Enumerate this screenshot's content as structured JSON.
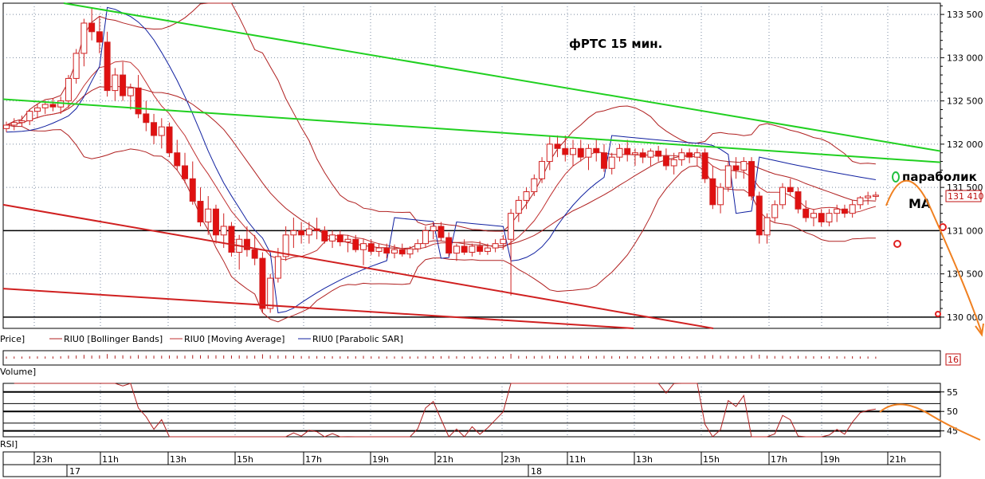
{
  "chart_data": [
    {
      "type": "candlestick",
      "title": "фРТС   15 мин.",
      "y_ticks": [
        130000,
        130500,
        131000,
        131500,
        132000,
        132500,
        133000,
        133500
      ],
      "y_tick_labels": [
        "130 000",
        "130 500",
        "131 000",
        "131 500",
        "132 000",
        "132 500",
        "133 000",
        "133 500"
      ],
      "ylim": [
        129870,
        133630
      ],
      "last_price": 131410,
      "last_price_label": "131 410",
      "x_time_labels": [
        "23h",
        "11h",
        "13h",
        "15h",
        "17h",
        "19h",
        "21h",
        "23h",
        "11h",
        "13h",
        "15h",
        "17h",
        "19h",
        "21h"
      ],
      "x_date_labels": [
        "17",
        "18"
      ],
      "legend": [
        "Price]",
        "RIU0 [Bollinger Bands]",
        "RIU0 [Moving Average]",
        "RIU0 [Parabolic SAR]"
      ],
      "annotations": [
        "параболик",
        "MA"
      ],
      "candles": [
        [
          132180,
          132260,
          132140,
          132220
        ],
        [
          132220,
          132300,
          132160,
          132250
        ],
        [
          132250,
          132330,
          132200,
          132270
        ],
        [
          132270,
          132400,
          132220,
          132380
        ],
        [
          132380,
          132470,
          132300,
          132420
        ],
        [
          132420,
          132500,
          132350,
          132460
        ],
        [
          132460,
          132530,
          132380,
          132430
        ],
        [
          132430,
          132550,
          132350,
          132500
        ],
        [
          132500,
          132800,
          132420,
          132760
        ],
        [
          132760,
          133100,
          132700,
          133050
        ],
        [
          133050,
          133450,
          132900,
          133400
        ],
        [
          133400,
          133580,
          133200,
          133300
        ],
        [
          133300,
          133480,
          133050,
          133180
        ],
        [
          133180,
          133300,
          132550,
          132620
        ],
        [
          132620,
          132880,
          132500,
          132800
        ],
        [
          132800,
          132950,
          132500,
          132560
        ],
        [
          132560,
          132700,
          132400,
          132650
        ],
        [
          132650,
          132800,
          132300,
          132350
        ],
        [
          132350,
          132500,
          132150,
          132250
        ],
        [
          132250,
          132350,
          132000,
          132100
        ],
        [
          132100,
          132300,
          131950,
          132200
        ],
        [
          132200,
          132250,
          131850,
          131900
        ],
        [
          131900,
          132050,
          131700,
          131750
        ],
        [
          131750,
          131900,
          131550,
          131600
        ],
        [
          131600,
          131800,
          131300,
          131340
        ],
        [
          131340,
          131500,
          131050,
          131100
        ],
        [
          131100,
          131400,
          130950,
          131250
        ],
        [
          131250,
          131300,
          130850,
          130950
        ],
        [
          130950,
          131200,
          130800,
          131050
        ],
        [
          131050,
          131100,
          130700,
          130750
        ],
        [
          130750,
          130950,
          130550,
          130900
        ],
        [
          130900,
          131050,
          130700,
          130780
        ],
        [
          130780,
          130950,
          130600,
          130680
        ],
        [
          130680,
          130750,
          130050,
          130100
        ],
        [
          130100,
          130500,
          130050,
          130450
        ],
        [
          130450,
          130800,
          130400,
          130700
        ],
        [
          130700,
          131050,
          130650,
          130950
        ],
        [
          130950,
          131150,
          130800,
          131000
        ],
        [
          131000,
          131100,
          130850,
          130950
        ],
        [
          130950,
          131100,
          130850,
          131020
        ],
        [
          131020,
          131150,
          130900,
          131000
        ],
        [
          131000,
          131050,
          130850,
          130880
        ],
        [
          130880,
          131000,
          130800,
          130950
        ],
        [
          130950,
          131000,
          130820,
          130870
        ],
        [
          130870,
          130950,
          130750,
          130900
        ],
        [
          130900,
          130950,
          130750,
          130780
        ],
        [
          130780,
          130900,
          130600,
          130850
        ],
        [
          130850,
          130900,
          130720,
          130760
        ],
        [
          130760,
          130850,
          130700,
          130800
        ],
        [
          130800,
          130850,
          130680,
          130740
        ],
        [
          130740,
          130840,
          130680,
          130780
        ],
        [
          130780,
          130850,
          130700,
          130730
        ],
        [
          130730,
          130820,
          130680,
          130790
        ],
        [
          130790,
          130900,
          130750,
          130850
        ],
        [
          130850,
          131050,
          130800,
          131000
        ],
        [
          131000,
          131100,
          130900,
          131050
        ],
        [
          131050,
          131100,
          130880,
          130920
        ],
        [
          130920,
          130980,
          130700,
          130740
        ],
        [
          130740,
          130850,
          130650,
          130820
        ],
        [
          130820,
          130900,
          130720,
          130750
        ],
        [
          130750,
          130850,
          130700,
          130820
        ],
        [
          130820,
          130880,
          130720,
          130760
        ],
        [
          130760,
          130850,
          130720,
          130800
        ],
        [
          130800,
          130900,
          130750,
          130850
        ],
        [
          130850,
          130950,
          130780,
          130900
        ],
        [
          130900,
          131250,
          130250,
          131200
        ],
        [
          131200,
          131400,
          131100,
          131350
        ],
        [
          131350,
          131500,
          131250,
          131450
        ],
        [
          131450,
          131650,
          131400,
          131600
        ],
        [
          131600,
          131850,
          131550,
          131800
        ],
        [
          131800,
          132100,
          131700,
          132000
        ],
        [
          132000,
          132100,
          131850,
          131950
        ],
        [
          131950,
          132100,
          131800,
          131880
        ],
        [
          131880,
          132050,
          131750,
          131950
        ],
        [
          131950,
          132050,
          131800,
          131850
        ],
        [
          131850,
          132000,
          131700,
          131950
        ],
        [
          131950,
          132050,
          131800,
          131900
        ],
        [
          131900,
          132000,
          131680,
          131720
        ],
        [
          131720,
          131900,
          131650,
          131850
        ],
        [
          131850,
          132000,
          131800,
          131950
        ],
        [
          131950,
          132050,
          131800,
          131880
        ],
        [
          131880,
          131950,
          131750,
          131900
        ],
        [
          131900,
          131950,
          131780,
          131850
        ],
        [
          131850,
          131950,
          131750,
          131920
        ],
        [
          131920,
          131980,
          131800,
          131860
        ],
        [
          131860,
          131950,
          131700,
          131750
        ],
        [
          131750,
          131900,
          131650,
          131820
        ],
        [
          131820,
          131950,
          131750,
          131900
        ],
        [
          131900,
          131950,
          131780,
          131850
        ],
        [
          131850,
          131950,
          131750,
          131900
        ],
        [
          131900,
          131950,
          131550,
          131600
        ],
        [
          131600,
          131750,
          131250,
          131300
        ],
        [
          131300,
          131550,
          131200,
          131500
        ],
        [
          131500,
          131800,
          131450,
          131750
        ],
        [
          131750,
          131850,
          131600,
          131700
        ],
        [
          131700,
          131850,
          131600,
          131800
        ],
        [
          131800,
          131850,
          131350,
          131400
        ],
        [
          131400,
          131450,
          130850,
          130950
        ],
        [
          130950,
          131200,
          130850,
          131150
        ],
        [
          131150,
          131350,
          131100,
          131300
        ],
        [
          131300,
          131550,
          131250,
          131500
        ],
        [
          131500,
          131600,
          131400,
          131450
        ],
        [
          131450,
          131500,
          131200,
          131250
        ],
        [
          131250,
          131350,
          131100,
          131150
        ],
        [
          131150,
          131250,
          131050,
          131200
        ],
        [
          131200,
          131250,
          131050,
          131100
        ],
        [
          131100,
          131250,
          131050,
          131200
        ],
        [
          131200,
          131300,
          131100,
          131250
        ],
        [
          131250,
          131300,
          131150,
          131200
        ],
        [
          131200,
          131350,
          131150,
          131300
        ],
        [
          131300,
          131400,
          131250,
          131380
        ],
        [
          131380,
          131450,
          131300,
          131400
        ],
        [
          131400,
          131450,
          131350,
          131410
        ]
      ]
    },
    {
      "type": "bar",
      "ylabel": "Volume]",
      "last_value_label": "16"
    },
    {
      "type": "line",
      "ylabel": "RSI]",
      "y_ticks": [
        45,
        50,
        55
      ],
      "y_tick_labels": [
        "45",
        "50",
        "55"
      ],
      "ylim": [
        43.5,
        57.2
      ]
    }
  ],
  "colors": {
    "up_candle": "#ffffff",
    "down_candle": "#e01010",
    "wick": "#d02020",
    "bollinger": "#b02020",
    "moving_average": "#c03030",
    "parabolic_sar": "#1020a0",
    "trend_green": "#20d020",
    "trend_red": "#d02020",
    "horizontal_levels": "#000000",
    "forecast_orange": "#f08020",
    "price_tag": "#c01010"
  }
}
